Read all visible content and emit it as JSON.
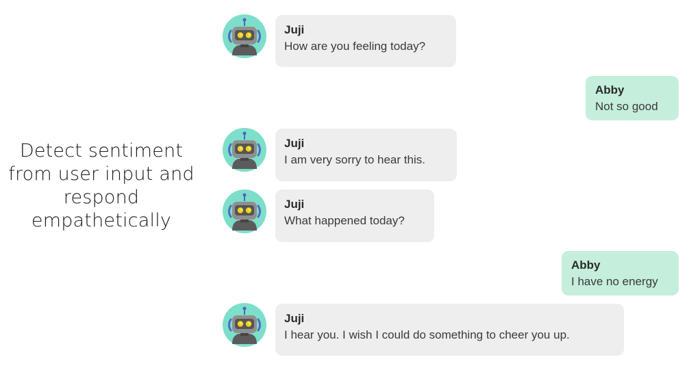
{
  "caption": {
    "lines": [
      "Detect sentiment",
      "from user input and",
      "respond",
      "empathetically"
    ]
  },
  "colors": {
    "bot_bubble": "#eeeeee",
    "user_bubble": "#c5eedd",
    "avatar_bg": "#7ddfc9",
    "robot_eye": "#f2d21b"
  },
  "icons": {
    "bot_avatar": "robot-icon"
  },
  "messages": [
    {
      "sender": "bot",
      "name": "Juji",
      "text": "How are you feeling today?"
    },
    {
      "sender": "user",
      "name": "Abby",
      "text": "Not so good"
    },
    {
      "sender": "bot",
      "name": "Juji",
      "text": "I am very sorry to hear this."
    },
    {
      "sender": "bot",
      "name": "Juji",
      "text": "What happened today?"
    },
    {
      "sender": "user",
      "name": "Abby",
      "text": "I have no energy"
    },
    {
      "sender": "bot",
      "name": "Juji",
      "text": "I hear you. I wish I could do something to cheer you up."
    }
  ]
}
